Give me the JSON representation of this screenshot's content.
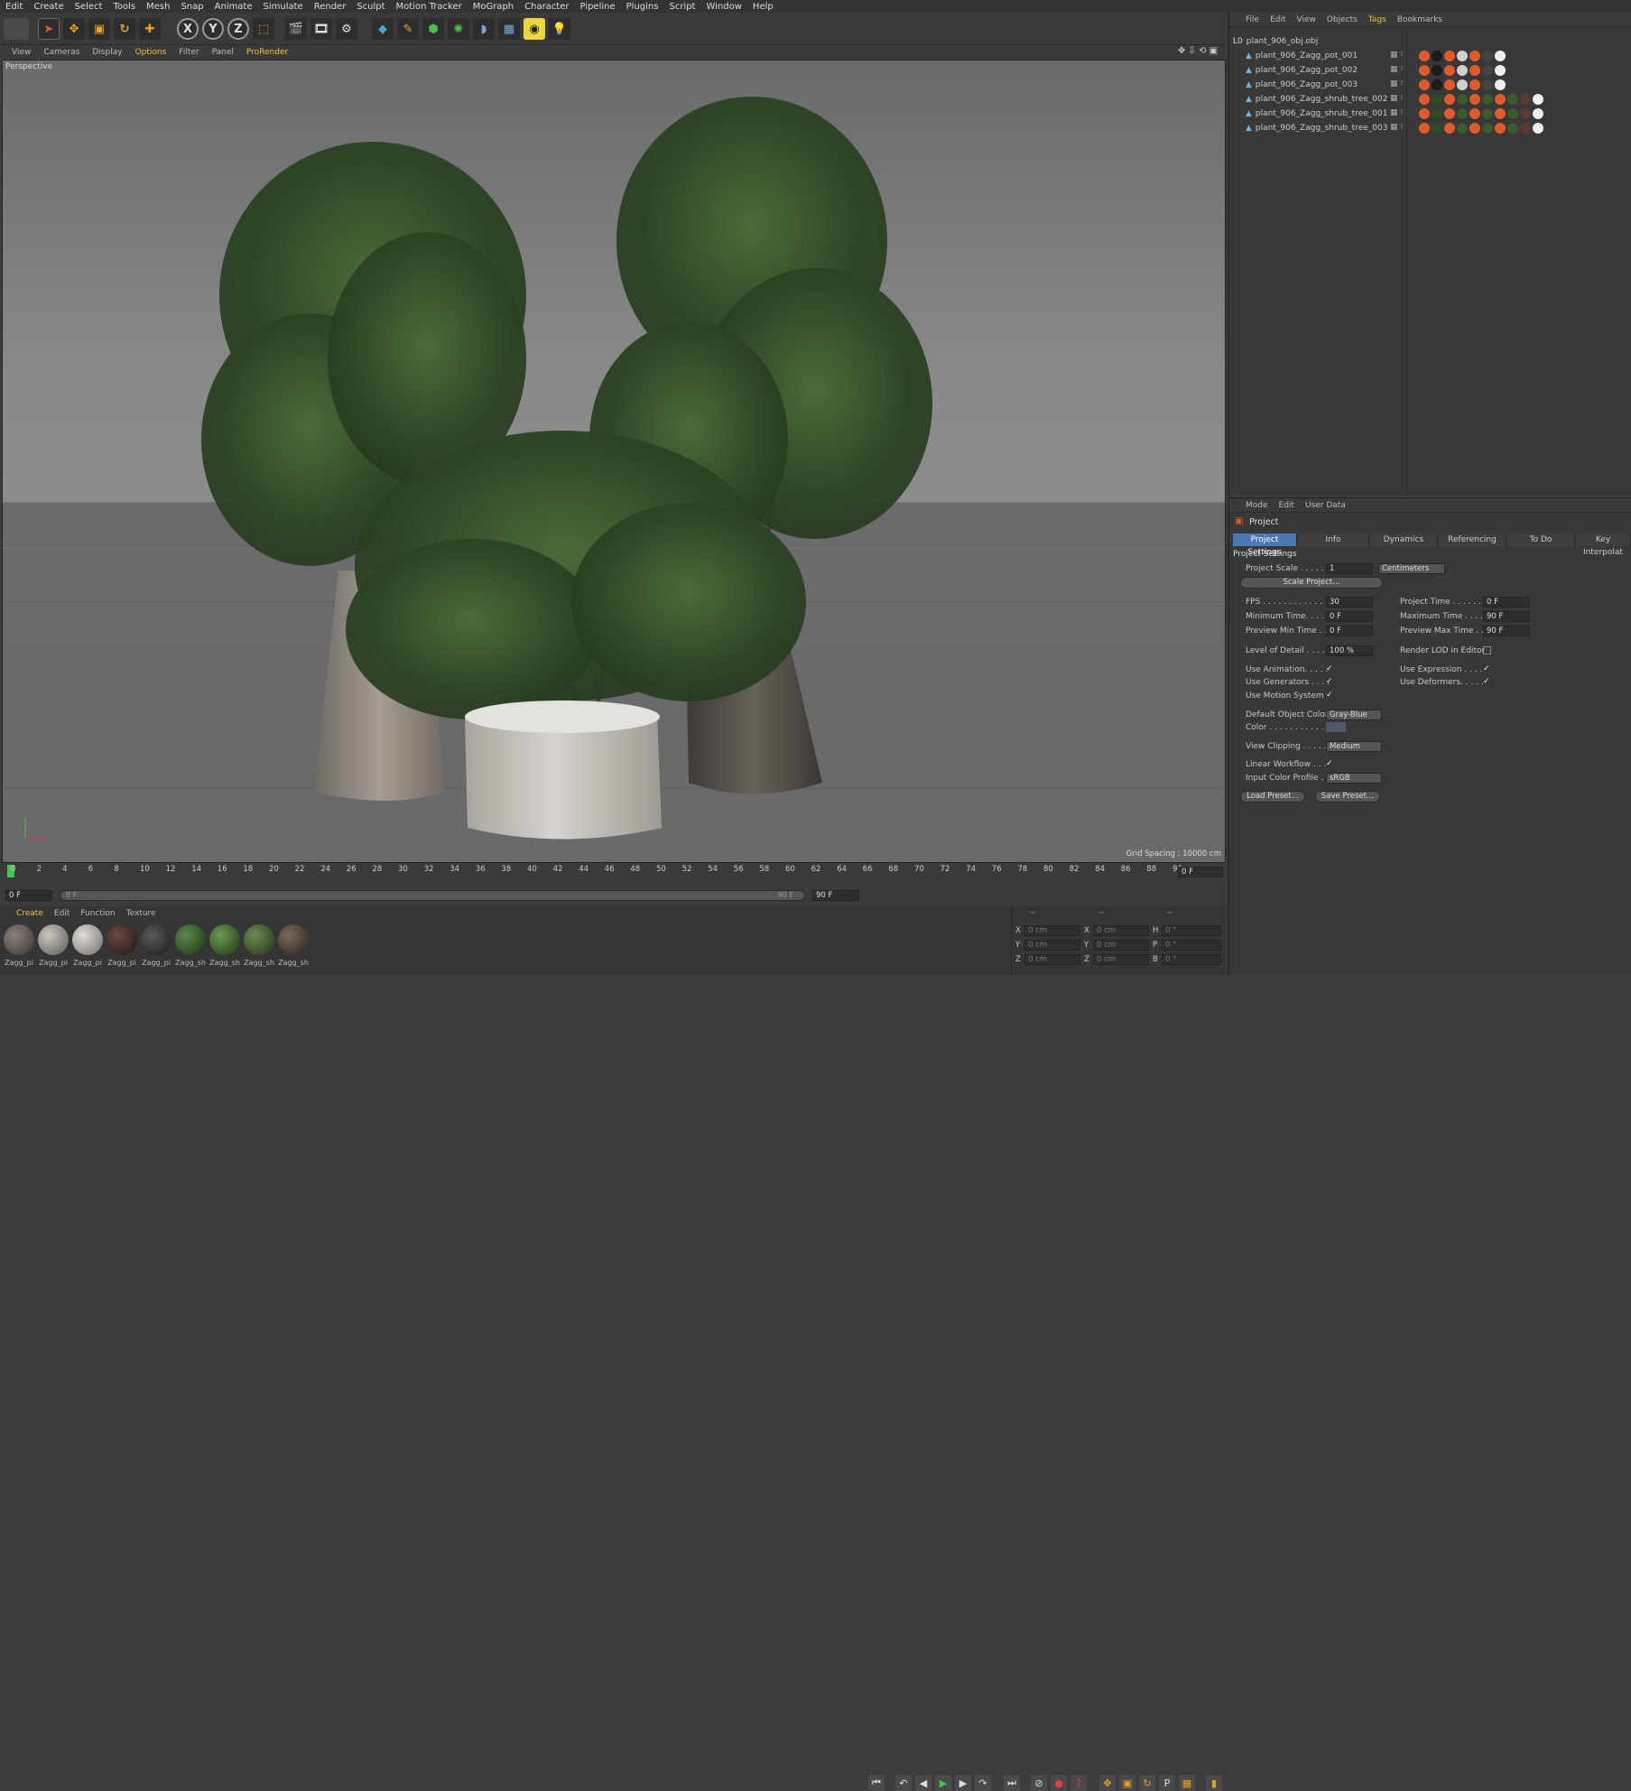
{
  "menubar": [
    "Edit",
    "Create",
    "Select",
    "Tools",
    "Mesh",
    "Snap",
    "Animate",
    "Simulate",
    "Render",
    "Sculpt",
    "Motion Tracker",
    "MoGraph",
    "Character",
    "Pipeline",
    "Plugins",
    "Script",
    "Window",
    "Help"
  ],
  "viewport_menu": [
    "View",
    "Cameras",
    "Display",
    "Options",
    "Filter",
    "Panel",
    "ProRender"
  ],
  "viewport": {
    "label": "Perspective",
    "grid_spacing": "Grid Spacing : 10000 cm"
  },
  "objmgr": {
    "menu": [
      "File",
      "Edit",
      "View",
      "Objects",
      "Tags",
      "Bookmarks"
    ],
    "root": "plant_906_obj.obj",
    "items": [
      "plant_906_Zagg_pot_001",
      "plant_906_Zagg_pot_002",
      "plant_906_Zagg_pot_003",
      "plant_906_Zagg_shrub_tree_002",
      "plant_906_Zagg_shrub_tree_001",
      "plant_906_Zagg_shrub_tree_003"
    ]
  },
  "attr": {
    "menu": [
      "Mode",
      "Edit",
      "User Data"
    ],
    "title": "Project",
    "tabs": [
      "Project Settings",
      "Info",
      "Dynamics",
      "Referencing",
      "To Do",
      "Key Interpolat"
    ],
    "section": "Project Settings",
    "project_scale_label": "Project Scale . . . . . . .",
    "project_scale": "1",
    "units": "Centimeters",
    "scale_project": "Scale Project...",
    "fps_label": "FPS . . . . . . . . . . . . . . .",
    "fps": "30",
    "project_time_label": "Project Time . . . . . . .",
    "project_time": "0 F",
    "min_time_label": "Minimum Time. . . . . .",
    "min_time": "0 F",
    "max_time_label": "Maximum Time . . . . .",
    "max_time": "90 F",
    "prev_min_label": "Preview Min Time . .",
    "prev_min": "0 F",
    "prev_max_label": "Preview Max Time . .",
    "prev_max": "90 F",
    "lod_label": "Level of Detail . . . . .",
    "lod": "100 %",
    "render_lod_label": "Render LOD in Editor",
    "use_anim_label": "Use Animation. . . . .",
    "use_expr_label": "Use Expression . . . .",
    "use_gen_label": "Use Generators . . . .",
    "use_def_label": "Use Deformers. . . . .",
    "use_motion_label": "Use Motion System",
    "def_color_label": "Default Object Color",
    "def_color": "Gray-Blue",
    "color_label": "Color . . . . . . . . . . .",
    "view_clip_label": "View Clipping . . . . .",
    "view_clip": "Medium",
    "linear_label": "Linear Workflow . . .",
    "input_profile_label": "Input Color Profile .",
    "input_profile": "sRGB",
    "load_preset": "Load Preset...",
    "save_preset": "Save Preset..."
  },
  "timeline": {
    "ticks": [
      "0",
      "2",
      "4",
      "6",
      "8",
      "10",
      "12",
      "14",
      "16",
      "18",
      "20",
      "22",
      "24",
      "26",
      "28",
      "30",
      "32",
      "34",
      "36",
      "38",
      "40",
      "42",
      "44",
      "46",
      "48",
      "50",
      "52",
      "54",
      "56",
      "58",
      "60",
      "62",
      "64",
      "66",
      "68",
      "70",
      "72",
      "74",
      "76",
      "78",
      "80",
      "82",
      "84",
      "86",
      "88",
      "90"
    ],
    "current": "0 F",
    "start": "0 F",
    "range_start": "0 F",
    "range_end": "90 F",
    "end": "90 F"
  },
  "matbar": {
    "menu": [
      "Create",
      "Edit",
      "Function",
      "Texture"
    ],
    "materials": [
      "Zagg_pi",
      "Zagg_pi",
      "Zagg_pi",
      "Zagg_pi",
      "Zagg_pi",
      "Zagg_sh",
      "Zagg_sh",
      "Zagg_sh",
      "Zagg_sh"
    ]
  },
  "coords": {
    "header": [
      "--",
      "--",
      "--"
    ],
    "rows": [
      {
        "a": "X",
        "av": "0 cm",
        "b": "X",
        "bv": "0 cm",
        "c": "H",
        "cv": "0 °"
      },
      {
        "a": "Y",
        "av": "0 cm",
        "b": "Y",
        "bv": "0 cm",
        "c": "P",
        "cv": "0 °"
      },
      {
        "a": "Z",
        "av": "0 cm",
        "b": "Z",
        "bv": "0 cm",
        "c": "B",
        "cv": "0 °"
      }
    ]
  },
  "colors": {
    "accent": "#4a7ab8",
    "tab_active": "#4a78b5",
    "bg": "#3d3d3d"
  }
}
